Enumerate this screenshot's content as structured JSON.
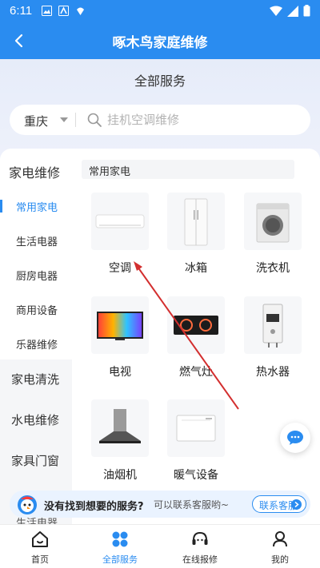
{
  "status": {
    "time": "6:11"
  },
  "appbar": {
    "title": "啄木鸟家庭维修"
  },
  "header": {
    "subtitle": "全部服务"
  },
  "search": {
    "city": "重庆",
    "placeholder": "挂机空调维修"
  },
  "category": {
    "title": "家电维修",
    "selected_sub": "常用家电"
  },
  "subcategories": [
    "常用家电",
    "生活电器",
    "厨房电器",
    "商用设备",
    "乐器维修"
  ],
  "categories": [
    "家电清洗",
    "水电维修",
    "家具门窗"
  ],
  "services": [
    "空调",
    "冰箱",
    "洗衣机",
    "电视",
    "燃气灶",
    "热水器",
    "油烟机",
    "暖气设备"
  ],
  "banner": {
    "question": "没有找到想要的服务?",
    "hint": "可以联系客服哟~",
    "button": "联系客服"
  },
  "peek_text": "生活电器",
  "tabs": [
    "首页",
    "全部服务",
    "在线报修",
    "我的"
  ],
  "colors": {
    "brand": "#2a8cf0",
    "arrow": "#d32f2f"
  }
}
